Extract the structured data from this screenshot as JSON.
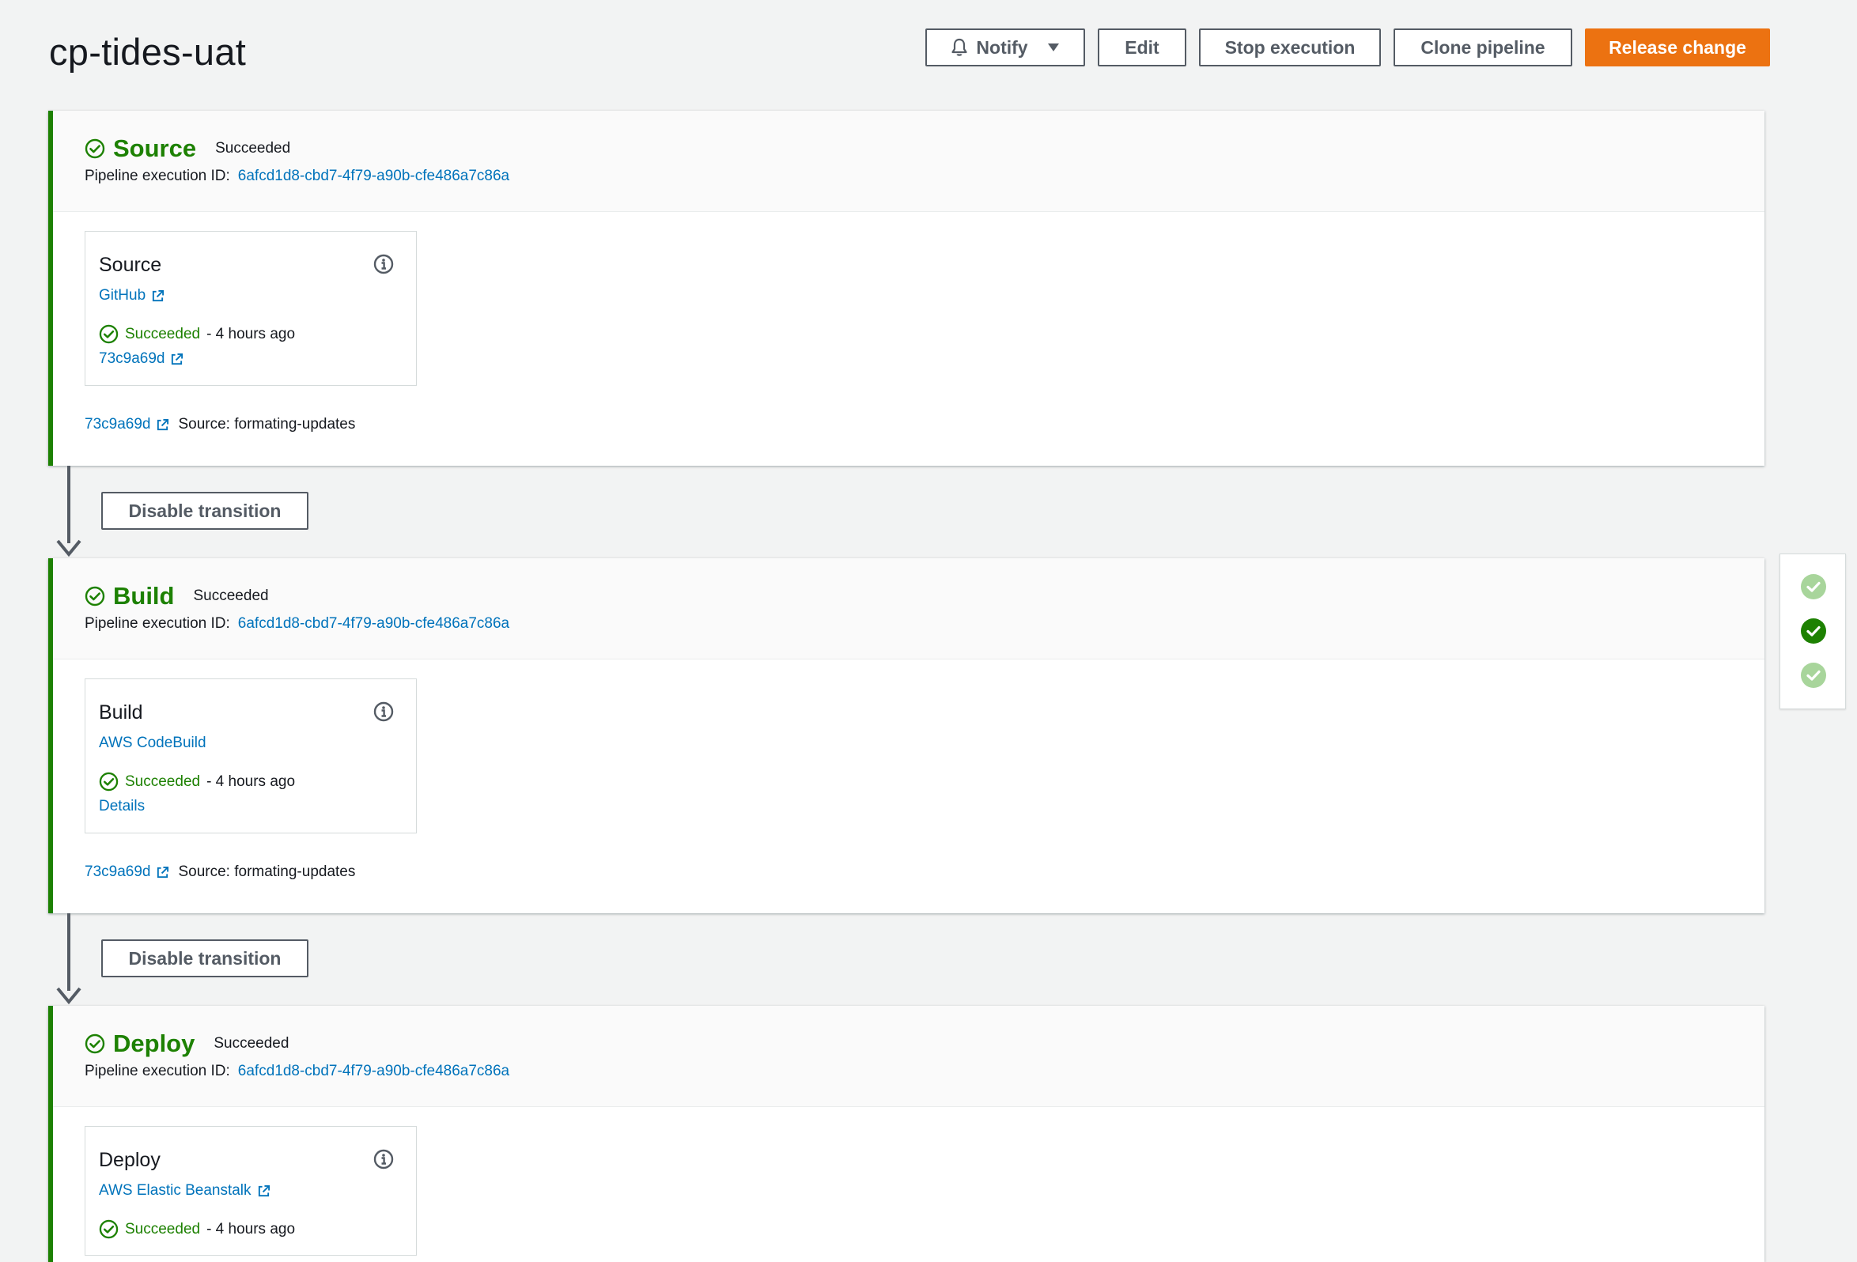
{
  "header": {
    "title": "cp-tides-uat",
    "buttons": {
      "notify": "Notify",
      "edit": "Edit",
      "stop": "Stop execution",
      "clone": "Clone pipeline",
      "release": "Release change"
    }
  },
  "colors": {
    "success": "#1d8102",
    "link": "#0073bb",
    "primary": "#ec7211",
    "border": "#545b64"
  },
  "exec_label": "Pipeline execution ID:",
  "stages": [
    {
      "name": "Source",
      "status": "Succeeded",
      "execution_id": "6afcd1d8-cbd7-4f79-a90b-cfe486a7c86a",
      "action": {
        "name": "Source",
        "provider": "GitHub",
        "status": "Succeeded",
        "time": "- 4 hours ago",
        "link": "73c9a69d"
      },
      "footer": {
        "commit": "73c9a69d",
        "source": "Source: formating-updates"
      }
    },
    {
      "name": "Build",
      "status": "Succeeded",
      "execution_id": "6afcd1d8-cbd7-4f79-a90b-cfe486a7c86a",
      "action": {
        "name": "Build",
        "provider": "AWS CodeBuild",
        "status": "Succeeded",
        "time": "- 4 hours ago",
        "link": "Details"
      },
      "footer": {
        "commit": "73c9a69d",
        "source": "Source: formating-updates"
      }
    },
    {
      "name": "Deploy",
      "status": "Succeeded",
      "execution_id": "6afcd1d8-cbd7-4f79-a90b-cfe486a7c86a",
      "action": {
        "name": "Deploy",
        "provider": "AWS Elastic Beanstalk",
        "status": "Succeeded",
        "time": "- 4 hours ago"
      }
    }
  ],
  "transitions": [
    {
      "label": "Disable transition"
    },
    {
      "label": "Disable transition"
    }
  ],
  "icons": {
    "notify": "bell-icon",
    "dropdown": "caret-down-icon",
    "status": "check-circle-icon",
    "info": "info-icon",
    "external": "external-link-icon"
  }
}
